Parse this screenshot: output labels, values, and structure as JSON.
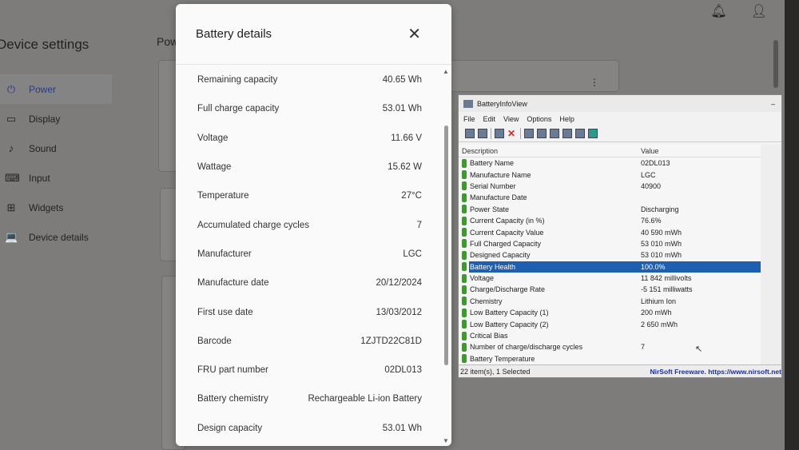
{
  "settings": {
    "title": "Device settings",
    "header_partial": "Pow",
    "nav": [
      {
        "icon": "plug-icon",
        "glyph": "⏻",
        "label": "Power",
        "active": true
      },
      {
        "icon": "display-icon",
        "glyph": "▭",
        "label": "Display"
      },
      {
        "icon": "music-note-icon",
        "glyph": "♪",
        "label": "Sound"
      },
      {
        "icon": "keyboard-icon",
        "glyph": "⌨",
        "label": "Input"
      },
      {
        "icon": "widgets-icon",
        "glyph": "⊞",
        "label": "Widgets"
      },
      {
        "icon": "laptop-icon",
        "glyph": "💻",
        "label": "Device details"
      }
    ]
  },
  "dialog": {
    "title": "Battery details",
    "close": "✕",
    "rows": [
      {
        "label": "Remaining capacity",
        "value": "40.65 Wh"
      },
      {
        "label": "Full charge capacity",
        "value": "53.01 Wh"
      },
      {
        "label": "Voltage",
        "value": "11.66 V"
      },
      {
        "label": "Wattage",
        "value": "15.62 W"
      },
      {
        "label": "Temperature",
        "value": "27°C"
      },
      {
        "label": "Accumulated charge cycles",
        "value": "7"
      },
      {
        "label": "Manufacturer",
        "value": "LGC"
      },
      {
        "label": "Manufacture date",
        "value": "20/12/2024"
      },
      {
        "label": "First use date",
        "value": "13/03/2012"
      },
      {
        "label": "Barcode",
        "value": "1ZJTD22C81D"
      },
      {
        "label": "FRU part number",
        "value": "02DL013"
      },
      {
        "label": "Battery chemistry",
        "value": "Rechargeable Li-ion Battery"
      },
      {
        "label": "Design capacity",
        "value": "53.01 Wh"
      }
    ]
  },
  "biv": {
    "title": "BatteryInfoView",
    "minimize": "–",
    "menu": [
      "File",
      "Edit",
      "View",
      "Options",
      "Help"
    ],
    "columns": [
      "Description",
      "Value"
    ],
    "rows": [
      {
        "d": "Battery Name",
        "v": "02DL013"
      },
      {
        "d": "Manufacture Name",
        "v": "LGC"
      },
      {
        "d": "Serial Number",
        "v": "40900"
      },
      {
        "d": "Manufacture Date",
        "v": ""
      },
      {
        "d": "Power State",
        "v": "Discharging"
      },
      {
        "d": "Current Capacity (in %)",
        "v": "76.6%"
      },
      {
        "d": "Current Capacity Value",
        "v": "40 590 mWh"
      },
      {
        "d": "Full Charged Capacity",
        "v": "53 010 mWh"
      },
      {
        "d": "Designed Capacity",
        "v": "53 010 mWh"
      },
      {
        "d": "Battery Health",
        "v": "100.0%",
        "selected": true
      },
      {
        "d": "Voltage",
        "v": "11 842 millivolts"
      },
      {
        "d": "Charge/Discharge Rate",
        "v": "-5 151 milliwatts"
      },
      {
        "d": "Chemistry",
        "v": "Lithium Ion"
      },
      {
        "d": "Low Battery Capacity (1)",
        "v": "200 mWh"
      },
      {
        "d": "Low Battery Capacity (2)",
        "v": "2 650 mWh"
      },
      {
        "d": "Critical Bias",
        "v": ""
      },
      {
        "d": "Number of charge/discharge cycles",
        "v": "7"
      },
      {
        "d": "Battery Temperature",
        "v": ""
      }
    ],
    "status": "22 item(s), 1 Selected",
    "link": "NirSoft Freeware. https://www.nirsoft.net"
  }
}
